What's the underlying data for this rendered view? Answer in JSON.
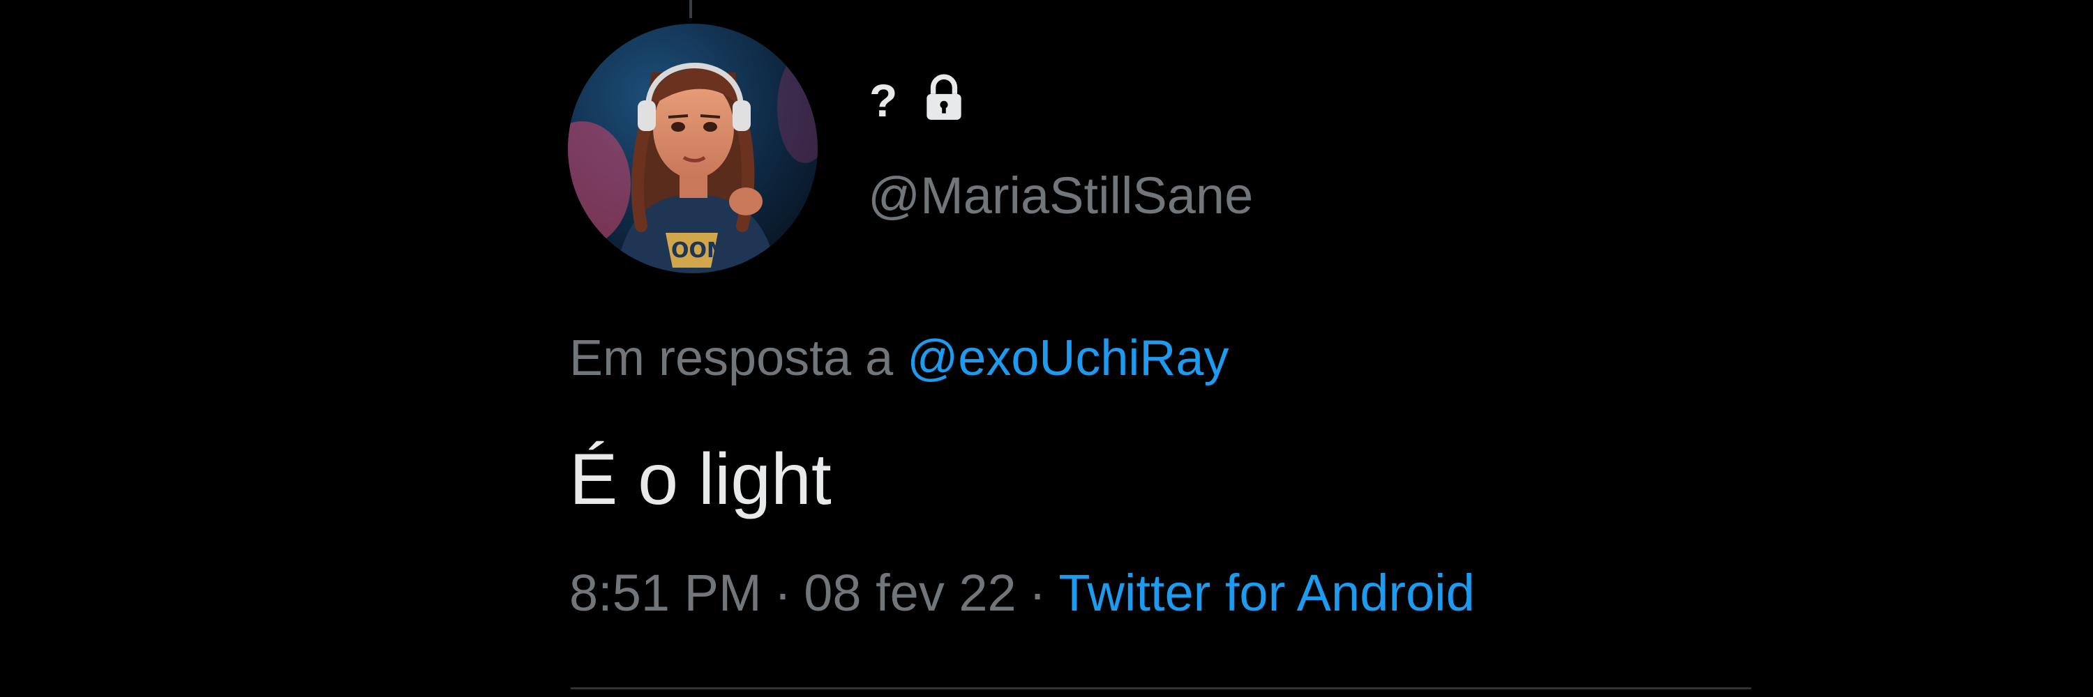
{
  "tweet": {
    "display_name": "?",
    "lock_icon": "lock-icon",
    "handle": "@MariaStillSane",
    "reply_prefix": "Em resposta a",
    "reply_to": "@exoUchiRay",
    "text": "É o light",
    "time": "8:51 PM",
    "date": "08 fev 22",
    "source": "Twitter for Android",
    "separator": "·"
  },
  "colors": {
    "background": "#000000",
    "primary_text": "#e7e9ea",
    "secondary_text": "#71767b",
    "link": "#1d9bf0"
  }
}
